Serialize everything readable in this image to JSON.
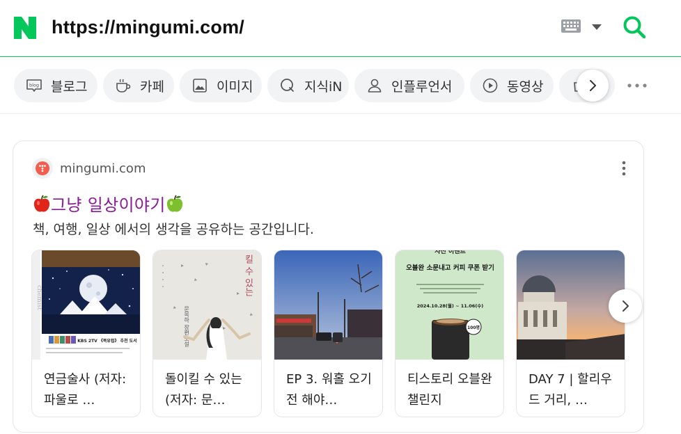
{
  "search": {
    "query": "https://mingumi.com/"
  },
  "icons": {
    "logo": "naver-n-logo",
    "keyboard": "keyboard-icon",
    "dropdown": "caret-down-icon",
    "search": "search-icon"
  },
  "colors": {
    "brand": "#03c75a",
    "title": "#8a1a97",
    "favicon": "#f25d4e"
  },
  "chips": [
    {
      "label": "블로그",
      "icon": "blog-icon"
    },
    {
      "label": "카페",
      "icon": "cafe-cup-icon"
    },
    {
      "label": "이미지",
      "icon": "image-icon"
    },
    {
      "label": "지식iN",
      "icon": "knowledge-q-icon"
    },
    {
      "label": "인플루언서",
      "icon": "person-icon"
    },
    {
      "label": "동영상",
      "icon": "play-circle-icon"
    }
  ],
  "result": {
    "site": "mingumi.com",
    "title": "그냥 일상이야기",
    "description": "책, 여행, 일상 에서의 생각을 공유하는 공간입니다.",
    "thumbnails": [
      {
        "caption": "연금술사 (저자: 파울로 …",
        "book_label": "KBS 2TV 《북유럽》 추천 도서",
        "spine": "chemist"
      },
      {
        "caption": "돌이킬 수 있는 (저자: 문…",
        "cover_text": "킬 수 있는",
        "author": "문목하 장편소설"
      },
      {
        "caption": "EP 3. 워홀 오기 전 해야…"
      },
      {
        "caption": "티스토리 오블완 챌린지",
        "poster_title": "오블완 소문내고 커피 쿠폰 받기",
        "poster_date": "2024.10.28(월) ~ 11.06(수)",
        "badge": "100명"
      },
      {
        "caption": "DAY 7 | 할리우드 거리, …"
      }
    ]
  }
}
